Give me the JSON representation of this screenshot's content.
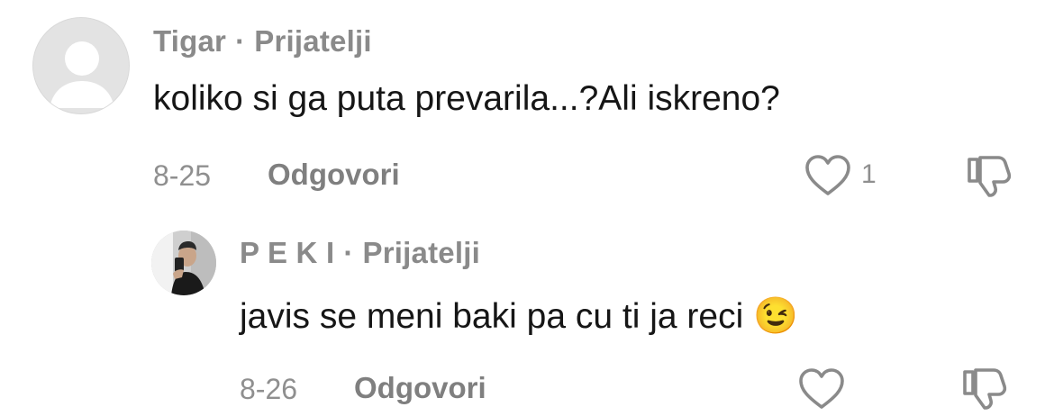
{
  "comments": [
    {
      "username": "Tigar",
      "separator": "·",
      "relation": "Prijatelji",
      "text": "koliko si ga puta prevarila...?Ali iskreno?",
      "date": "8-25",
      "reply_label": "Odgovori",
      "likes": "1"
    }
  ],
  "replies": [
    {
      "username": "P E K I",
      "separator": "·",
      "relation": "Prijatelji",
      "text": "javis se meni baki pa cu ti ja reci",
      "emoji": "😉",
      "date": "8-26",
      "reply_label": "Odgovori"
    }
  ],
  "icons": {
    "like": "heart-outline-icon",
    "dislike": "thumbs-down-outline-icon",
    "default_avatar": "person-silhouette-icon"
  },
  "colors": {
    "username": "#8a8a8a",
    "text": "#161616",
    "meta": "#8f8f8f",
    "icon_stroke": "#8a8a8a"
  }
}
